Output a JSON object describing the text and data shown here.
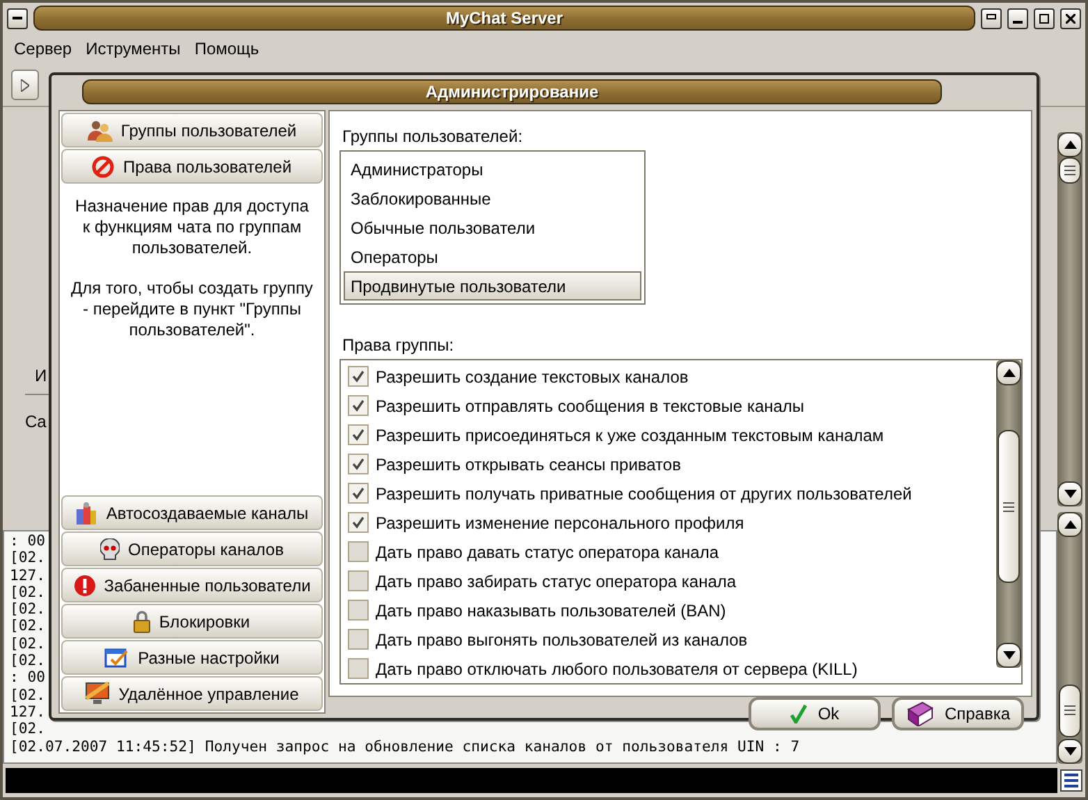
{
  "window": {
    "title": "MyChat Server"
  },
  "menu": [
    "Сервер",
    "Иструменты",
    "Помощь"
  ],
  "background_pane": {
    "texts": [
      "И",
      "Ca"
    ]
  },
  "log": {
    "lines": [
      ": 00",
      "[02.",
      "127.",
      "[02.",
      "[02.",
      "[02.",
      "[02.",
      "[02.",
      ": 00",
      "[02.",
      "127.",
      "[02.",
      "[02.07.2007 11:45:52] Получен запрос на обновление списка каналов от пользователя UIN : 7"
    ]
  },
  "dialog": {
    "title": "Администрирование",
    "nav_top": [
      "Группы пользователей",
      "Права пользователей"
    ],
    "description": [
      "Назначение прав для доступа к функциям чата по группам пользователей.",
      "Для того, чтобы создать группу - перейдите в пункт \"Группы пользователей\"."
    ],
    "nav_bottom": [
      "Автосоздаваемые каналы",
      "Операторы каналов",
      "Забаненные пользователи",
      "Блокировки",
      "Разные настройки",
      "Удалённое управление"
    ],
    "groups_label": "Группы пользователей:",
    "groups": [
      {
        "label": "Администраторы",
        "selected": false
      },
      {
        "label": "Заблокированные",
        "selected": false
      },
      {
        "label": "Обычные пользователи",
        "selected": false
      },
      {
        "label": "Операторы",
        "selected": false
      },
      {
        "label": "Продвинутые пользователи",
        "selected": true
      }
    ],
    "rights_label": "Права группы:",
    "rights": [
      {
        "label": "Разрешить создание текстовых каналов",
        "checked": true
      },
      {
        "label": "Разрешить отправлять сообщения в текстовые каналы",
        "checked": true
      },
      {
        "label": "Разрешить присоединяться к уже созданным текстовым каналам",
        "checked": true
      },
      {
        "label": "Разрешить открывать сеансы приватов",
        "checked": true
      },
      {
        "label": "Разрешить получать приватные сообщения от других пользователей",
        "checked": true
      },
      {
        "label": "Разрешить изменение персонального профиля",
        "checked": true
      },
      {
        "label": "Дать право давать статус оператора канала",
        "checked": false
      },
      {
        "label": "Дать право забирать статус оператора канала",
        "checked": false
      },
      {
        "label": "Дать право наказывать пользователей (BAN)",
        "checked": false
      },
      {
        "label": "Дать право выгонять пользователей из каналов",
        "checked": false
      },
      {
        "label": "Дать право отключать любого пользователя от сервера (KILL)",
        "checked": false
      }
    ],
    "buttons": [
      "Ok",
      "Справка"
    ]
  }
}
